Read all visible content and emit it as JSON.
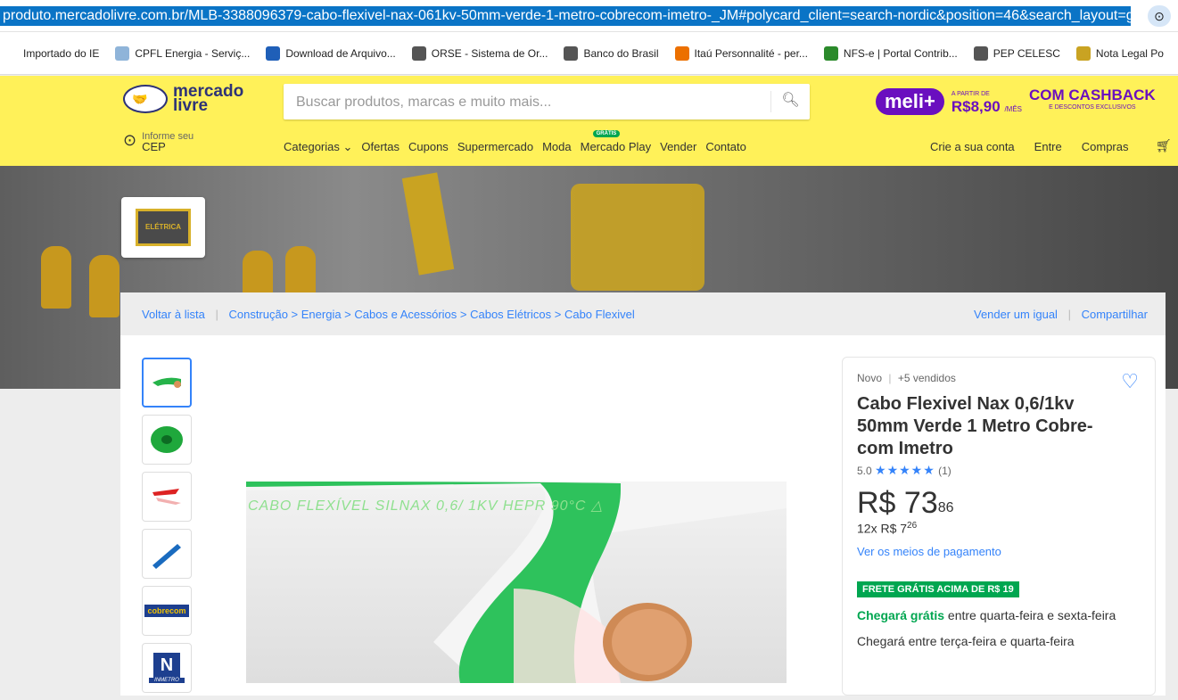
{
  "browser": {
    "url": "produto.mercadolivre.com.br/MLB-3388096379-cabo-flexivel-nax-061kv-50mm-verde-1-metro-cobrecom-imetro-_JM#polycard_client=search-nordic&position=46&search_layout=gr",
    "bookmarks": [
      {
        "label": "Importado do IE",
        "color": "#ffffff"
      },
      {
        "label": "CPFL Energia - Serviç...",
        "color": "#8fb4d9"
      },
      {
        "label": "Download de Arquivo...",
        "color": "#1f5fb8"
      },
      {
        "label": "ORSE - Sistema de Or...",
        "color": "#555555"
      },
      {
        "label": "Banco do Brasil",
        "color": "#555555"
      },
      {
        "label": "Itaú Personnalité - per...",
        "color": "#ec7000"
      },
      {
        "label": "NFS-e | Portal Contrib...",
        "color": "#2b8a2b"
      },
      {
        "label": "PEP CELESC",
        "color": "#555555"
      },
      {
        "label": "Nota Legal Po",
        "color": "#c9a322"
      }
    ]
  },
  "header": {
    "logo_line1": "mercado",
    "logo_line2": "livre",
    "search_placeholder": "Buscar produtos, marcas e muito mais...",
    "meli_badge": "meli+",
    "meli_small": "A PARTIR DE",
    "meli_price": "R$8,90",
    "meli_month": "/MÊS",
    "cashback": "COM CASHBACK",
    "cashback_small": "E DESCONTOS EXCLUSIVOS",
    "cep_small": "Informe seu",
    "cep": "CEP",
    "nav": [
      "Categorias ⌄",
      "Ofertas",
      "Cupons",
      "Supermercado",
      "Moda",
      "Mercado Play",
      "Vender",
      "Contato"
    ],
    "nav_play_badge": "GRÁTIS",
    "account": [
      "Crie a sua conta",
      "Entre",
      "Compras"
    ]
  },
  "store": {
    "logo_text": "ELÉTRICA"
  },
  "breadcrumb": {
    "back": "Voltar à lista",
    "path": "Construção > Energia > Cabos e Acessórios > Cabos Elétricos > Cabo Flexivel",
    "sell_same": "Vender um igual",
    "share": "Compartilhar"
  },
  "gallery": {
    "image_text": "CABO FLEXÍVEL SILNAX 0,6/ 1KV HEPR 90°C  △",
    "thumb_cobrecom": "cobrecom",
    "thumb_inmetro": "INMETRO"
  },
  "product": {
    "condition": "Novo",
    "sold": "+5 vendidos",
    "title": "Cabo Flexivel Nax 0,6/1kv 50mm Verde 1 Metro Cobre-com Imetro",
    "rating": "5.0",
    "stars": "★★★★★",
    "reviews": "(1)",
    "price_int": "R$ 73",
    "price_cents": "86",
    "installments": "12x R$ 7",
    "installment_cents": "26",
    "pay_link": "Ver os meios de pagamento",
    "free_badge": "FRETE GRÁTIS ACIMA DE R$ 19",
    "ship_free": "Chegará grátis",
    "ship_free_rest": " entre quarta-feira e sexta-feira",
    "ship2": "Chegará entre terça-feira e quarta-feira"
  }
}
